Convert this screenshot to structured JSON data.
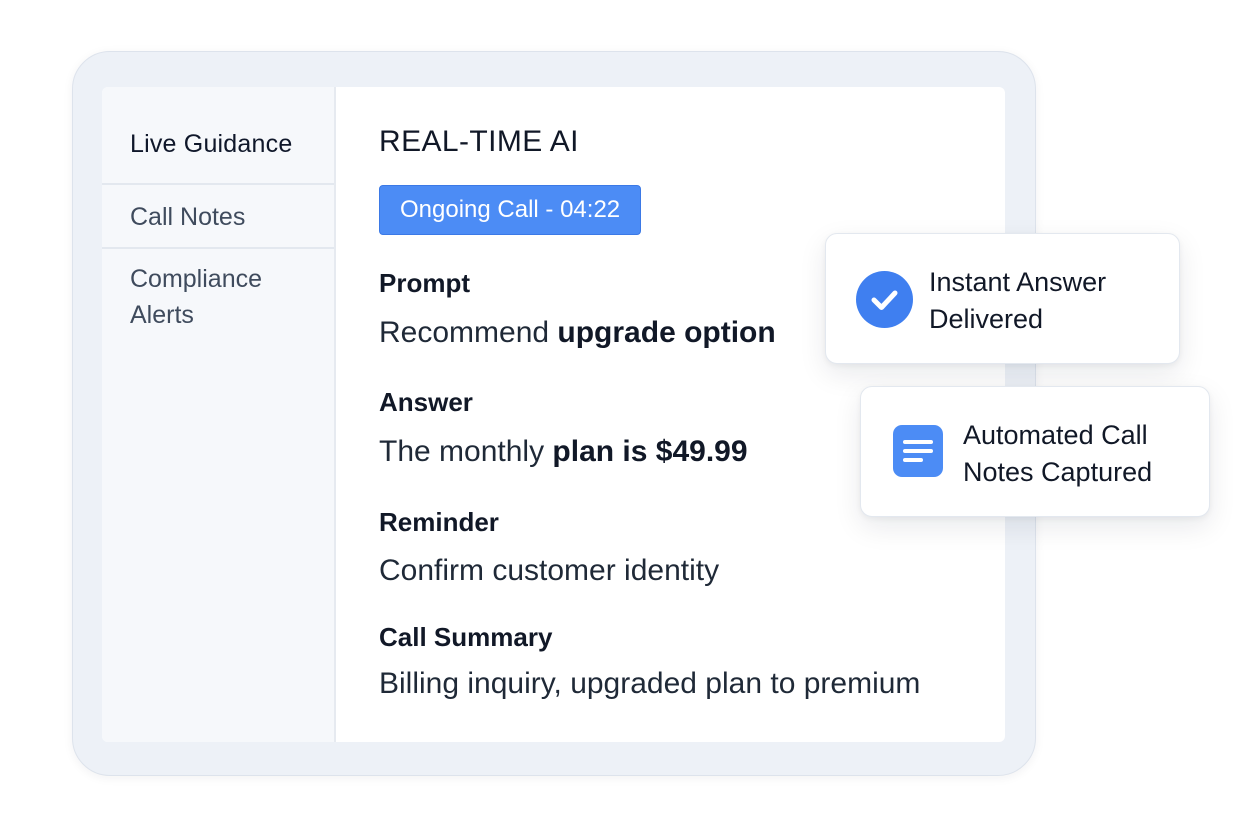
{
  "sidebar": {
    "items": [
      {
        "label": "Live Guidance"
      },
      {
        "label": "Call Notes"
      },
      {
        "label": "Compliance Alerts"
      }
    ]
  },
  "main": {
    "title": "REAL-TIME AI",
    "call_status": "Ongoing Call - 04:22",
    "prompt": {
      "label": "Prompt",
      "text_regular": "Recommend ",
      "text_bold": "upgrade option"
    },
    "answer": {
      "label": "Answer",
      "text_regular": "The monthly ",
      "text_bold": "plan is $49.99"
    },
    "reminder": {
      "label": "Reminder",
      "text": "Confirm customer identity"
    },
    "summary": {
      "label": "Call Summary",
      "text": "Billing inquiry, upgraded plan to premium"
    }
  },
  "cards": [
    {
      "text": "Instant Answer Delivered",
      "icon": "check-circle-icon"
    },
    {
      "text": "Automated Call Notes Captured",
      "icon": "document-icon"
    }
  ],
  "colors": {
    "accent": "#4c8cf5",
    "frame": "#edf1f7",
    "sidebar": "#f6f8fb"
  }
}
